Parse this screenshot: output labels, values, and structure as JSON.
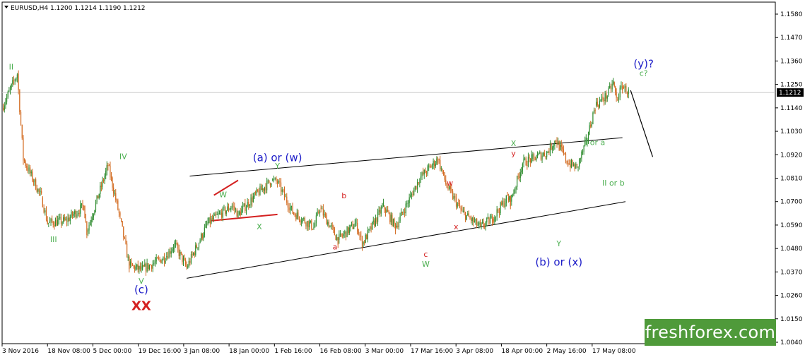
{
  "header": {
    "symbol_line": "EURUSD,H4  1.1200 1.1214 1.1190 1.1212"
  },
  "watermark": {
    "text": "freshforex.com",
    "bg_color": "#4f9a3a"
  },
  "chart_data": {
    "type": "candlestick",
    "symbol": "EURUSD",
    "timeframe": "H4",
    "ohlc_last": {
      "open": 1.12,
      "high": 1.1214,
      "low": 1.119,
      "close": 1.1212
    },
    "current_price": "1.1212",
    "ylim": [
      1.037,
      1.164
    ],
    "y_ticks": [
      "1.1580",
      "1.1470",
      "1.1360",
      "1.1250",
      "1.1140",
      "1.1030",
      "1.0920",
      "1.0810",
      "1.0700",
      "1.0590",
      "1.0480",
      "1.0370",
      "1.0260",
      "1.0150",
      "1.0040"
    ],
    "x_ticks": [
      "3 Nov 2016",
      "18 Nov 08:00",
      "5 Dec 00:00",
      "19 Dec 16:00",
      "3 Jan 08:00",
      "18 Jan 00:00",
      "1 Feb 16:00",
      "16 Feb 08:00",
      "3 Mar 00:00",
      "17 Mar 16:00",
      "3 Apr 08:00",
      "18 Apr 00:00",
      "2 May 16:00",
      "17 May 08:00"
    ],
    "colors": {
      "up": "#2e8b2e",
      "down": "#d2691e",
      "wave_blue": "#1c1cc8",
      "wave_green": "#4caf50",
      "wave_red": "#d42020",
      "channel": "#000000",
      "triangle": "#d42020"
    },
    "price_path": [
      {
        "date": "2016-11-03",
        "price": 1.114
      },
      {
        "date": "2016-11-08",
        "price": 1.13
      },
      {
        "date": "2016-11-10",
        "price": 1.09
      },
      {
        "date": "2016-11-16",
        "price": 1.072
      },
      {
        "date": "2016-11-18",
        "price": 1.06
      },
      {
        "date": "2016-11-24",
        "price": 1.061
      },
      {
        "date": "2016-11-30",
        "price": 1.068
      },
      {
        "date": "2016-12-01",
        "price": 1.056
      },
      {
        "date": "2016-12-08",
        "price": 1.087
      },
      {
        "date": "2016-12-12",
        "price": 1.062
      },
      {
        "date": "2016-12-15",
        "price": 1.04
      },
      {
        "date": "2016-12-19",
        "price": 1.038
      },
      {
        "date": "2016-12-27",
        "price": 1.044
      },
      {
        "date": "2016-12-30",
        "price": 1.05
      },
      {
        "date": "2017-01-03",
        "price": 1.039
      },
      {
        "date": "2017-01-10",
        "price": 1.06
      },
      {
        "date": "2017-01-18",
        "price": 1.068
      },
      {
        "date": "2017-01-20",
        "price": 1.064
      },
      {
        "date": "2017-01-25",
        "price": 1.072
      },
      {
        "date": "2017-01-31",
        "price": 1.08
      },
      {
        "date": "2017-02-02",
        "price": 1.079
      },
      {
        "date": "2017-02-07",
        "price": 1.065
      },
      {
        "date": "2017-02-14",
        "price": 1.058
      },
      {
        "date": "2017-02-16",
        "price": 1.067
      },
      {
        "date": "2017-02-22",
        "price": 1.052
      },
      {
        "date": "2017-02-28",
        "price": 1.06
      },
      {
        "date": "2017-03-02",
        "price": 1.05
      },
      {
        "date": "2017-03-09",
        "price": 1.068
      },
      {
        "date": "2017-03-13",
        "price": 1.058
      },
      {
        "date": "2017-03-21",
        "price": 1.081
      },
      {
        "date": "2017-03-27",
        "price": 1.09
      },
      {
        "date": "2017-03-30",
        "price": 1.077
      },
      {
        "date": "2017-04-04",
        "price": 1.065
      },
      {
        "date": "2017-04-10",
        "price": 1.058
      },
      {
        "date": "2017-04-14",
        "price": 1.062
      },
      {
        "date": "2017-04-19",
        "price": 1.072
      },
      {
        "date": "2017-04-20",
        "price": 1.07
      },
      {
        "date": "2017-04-24",
        "price": 1.088
      },
      {
        "date": "2017-04-27",
        "price": 1.09
      },
      {
        "date": "2017-05-02",
        "price": 1.093
      },
      {
        "date": "2017-05-05",
        "price": 1.099
      },
      {
        "date": "2017-05-09",
        "price": 1.088
      },
      {
        "date": "2017-05-12",
        "price": 1.086
      },
      {
        "date": "2017-05-15",
        "price": 1.098
      },
      {
        "date": "2017-05-18",
        "price": 1.115
      },
      {
        "date": "2017-05-22",
        "price": 1.12
      },
      {
        "date": "2017-05-24",
        "price": 1.126
      },
      {
        "date": "2017-05-25",
        "price": 1.118
      },
      {
        "date": "2017-05-27",
        "price": 1.124
      },
      {
        "date": "2017-05-29",
        "price": 1.1212
      }
    ],
    "forecast": [
      {
        "date": "2017-05-29",
        "price": 1.1222
      },
      {
        "date": "2017-06-06",
        "price": 1.091
      }
    ],
    "upper_channel": [
      {
        "date": "2017-01-04",
        "price": 1.082
      },
      {
        "date": "2017-05-27",
        "price": 1.1
      }
    ],
    "lower_channel": [
      {
        "date": "2017-01-03",
        "price": 1.034
      },
      {
        "date": "2017-05-28",
        "price": 1.07
      }
    ],
    "triangle": [
      [
        {
          "date": "2017-01-12",
          "price": 1.073
        },
        {
          "date": "2017-01-20",
          "price": 1.08
        }
      ],
      [
        {
          "date": "2017-01-11",
          "price": 1.061
        },
        {
          "date": "2017-02-02",
          "price": 1.064
        }
      ]
    ],
    "annotations": [
      {
        "text": "II",
        "color": "green",
        "date": "2016-11-06",
        "price": 1.132
      },
      {
        "text": "III",
        "color": "green",
        "date": "2016-11-20",
        "price": 1.051
      },
      {
        "text": "IV",
        "color": "green",
        "date": "2016-12-13",
        "price": 1.09
      },
      {
        "text": "V",
        "color": "green",
        "date": "2016-12-19",
        "price": 1.0315
      },
      {
        "text": "(c)",
        "color": "blue",
        "date": "2016-12-19",
        "price": 1.027
      },
      {
        "text": "XX",
        "color": "red",
        "date": "2016-12-19",
        "price": 1.019
      },
      {
        "text": "(a) or (w)",
        "color": "blue",
        "date": "2017-02-02",
        "price": 1.089
      },
      {
        "text": "W",
        "color": "green",
        "date": "2017-01-15",
        "price": 1.072
      },
      {
        "text": "Y",
        "color": "green",
        "date": "2017-02-02",
        "price": 1.0855
      },
      {
        "text": "X",
        "color": "green",
        "date": "2017-01-27",
        "price": 1.057
      },
      {
        "text": "a",
        "color": "red",
        "date": "2017-02-21",
        "price": 1.0475
      },
      {
        "text": "b",
        "color": "red",
        "date": "2017-02-24",
        "price": 1.0715
      },
      {
        "text": "c",
        "color": "red",
        "date": "2017-03-23",
        "price": 1.044
      },
      {
        "text": "W",
        "color": "green",
        "date": "2017-03-23",
        "price": 1.0395
      },
      {
        "text": "w",
        "color": "red",
        "date": "2017-03-31",
        "price": 1.0775
      },
      {
        "text": "x",
        "color": "red",
        "date": "2017-04-02",
        "price": 1.057
      },
      {
        "text": "X",
        "color": "green",
        "date": "2017-04-21",
        "price": 1.096
      },
      {
        "text": "y",
        "color": "red",
        "date": "2017-04-21",
        "price": 1.0915
      },
      {
        "text": "Y",
        "color": "green",
        "date": "2017-05-06",
        "price": 1.049
      },
      {
        "text": "(b) or (x)",
        "color": "blue",
        "date": "2017-05-06",
        "price": 1.04
      },
      {
        "text": "I or a",
        "color": "green",
        "date": "2017-05-18",
        "price": 1.0965
      },
      {
        "text": "II or b",
        "color": "green",
        "date": "2017-05-24",
        "price": 1.0775
      },
      {
        "text": "(y)?",
        "color": "blue",
        "date": "2017-06-03",
        "price": 1.133
      },
      {
        "text": "c?",
        "color": "green",
        "date": "2017-06-03",
        "price": 1.129
      }
    ]
  }
}
